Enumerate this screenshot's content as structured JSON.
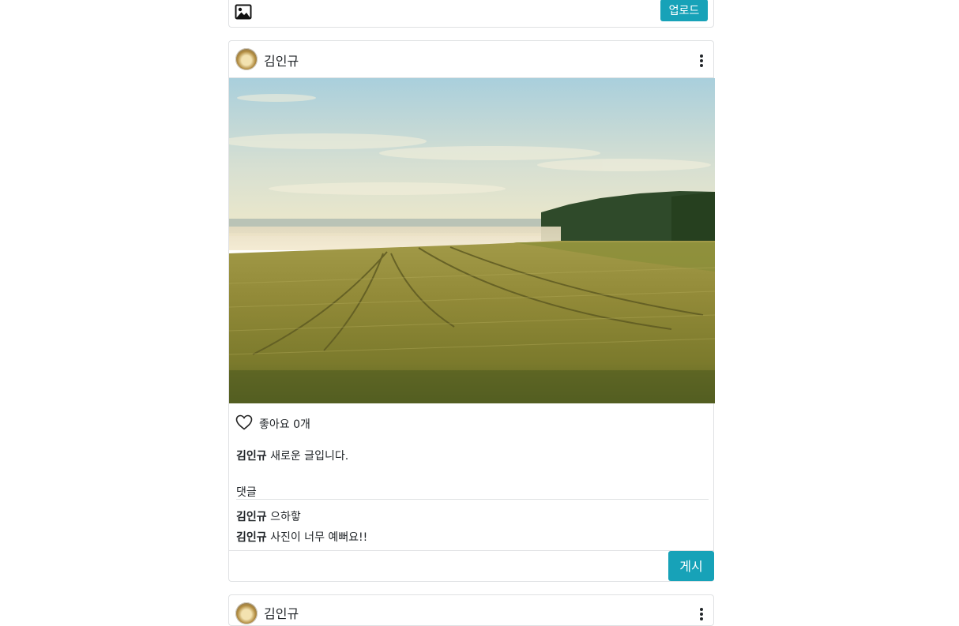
{
  "upload": {
    "button_label": "업로드"
  },
  "post": {
    "author": "김인규",
    "likes_text": "좋아요 0개",
    "caption": {
      "author": "김인규",
      "text": "새로운 글입니다."
    },
    "comment_label": "댓글",
    "comments": [
      {
        "author": "김인규",
        "text": "으하핳"
      },
      {
        "author": "김인규",
        "text": "사진이 너무 예뻐요!!"
      }
    ],
    "submit_label": "게시"
  },
  "next_post": {
    "author": "김인규"
  },
  "icons": {
    "image": "image-icon",
    "more": "more-vertical-icon",
    "like": "heart-outline-icon"
  },
  "colors": {
    "accent": "#17a2b8",
    "border": "#dfe1e3"
  }
}
